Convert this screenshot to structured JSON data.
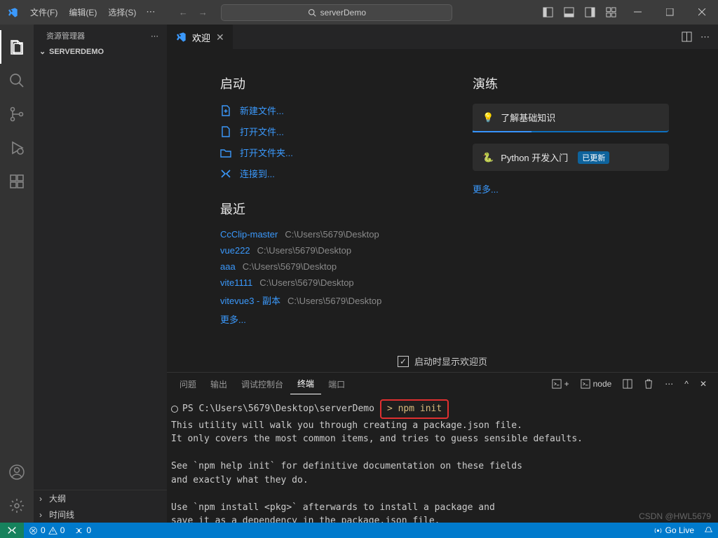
{
  "menubar": {
    "file": "文件(F)",
    "edit": "编辑(E)",
    "select": "选择(S)"
  },
  "search": {
    "text": "serverDemo"
  },
  "sidebar": {
    "title": "资源管理器",
    "folder": "SERVERDEMO",
    "outline": "大纲",
    "timeline": "时间线"
  },
  "tab": {
    "welcome": "欢迎"
  },
  "welcome": {
    "start_title": "启动",
    "new_file": "新建文件...",
    "open_file": "打开文件...",
    "open_folder": "打开文件夹...",
    "connect": "连接到...",
    "recent_title": "最近",
    "recent": [
      {
        "name": "CcClip-master",
        "path": "C:\\Users\\5679\\Desktop"
      },
      {
        "name": "vue222",
        "path": "C:\\Users\\5679\\Desktop"
      },
      {
        "name": "aaa",
        "path": "C:\\Users\\5679\\Desktop"
      },
      {
        "name": "vite1111",
        "path": "C:\\Users\\5679\\Desktop"
      },
      {
        "name": "vitevue3 - 副本",
        "path": "C:\\Users\\5679\\Desktop"
      }
    ],
    "more": "更多...",
    "walk_title": "演练",
    "learn_basics": "了解基础知识",
    "python_dev": "Python 开发入门",
    "updated_badge": "已更新",
    "walk_more": "更多...",
    "show_on_start": "启动时显示欢迎页"
  },
  "panel": {
    "tabs": {
      "problems": "问题",
      "output": "输出",
      "debug_console": "调试控制台",
      "terminal": "终端",
      "ports": "端口"
    },
    "term_label": "node"
  },
  "terminal": {
    "prompt": "PS C:\\Users\\5679\\Desktop\\serverDemo",
    "command": "> npm init",
    "body": "This utility will walk you through creating a package.json file.\nIt only covers the most common items, and tries to guess sensible defaults.\n\nSee `npm help init` for definitive documentation on these fields\nand exactly what they do.\n\nUse `npm install <pkg>` afterwards to install a package and\nsave it as a dependency in the package.json file."
  },
  "statusbar": {
    "errors": "0",
    "warnings": "0",
    "ports": "0",
    "golive": "Go Live"
  },
  "watermark": "CSDN @HWL5679"
}
